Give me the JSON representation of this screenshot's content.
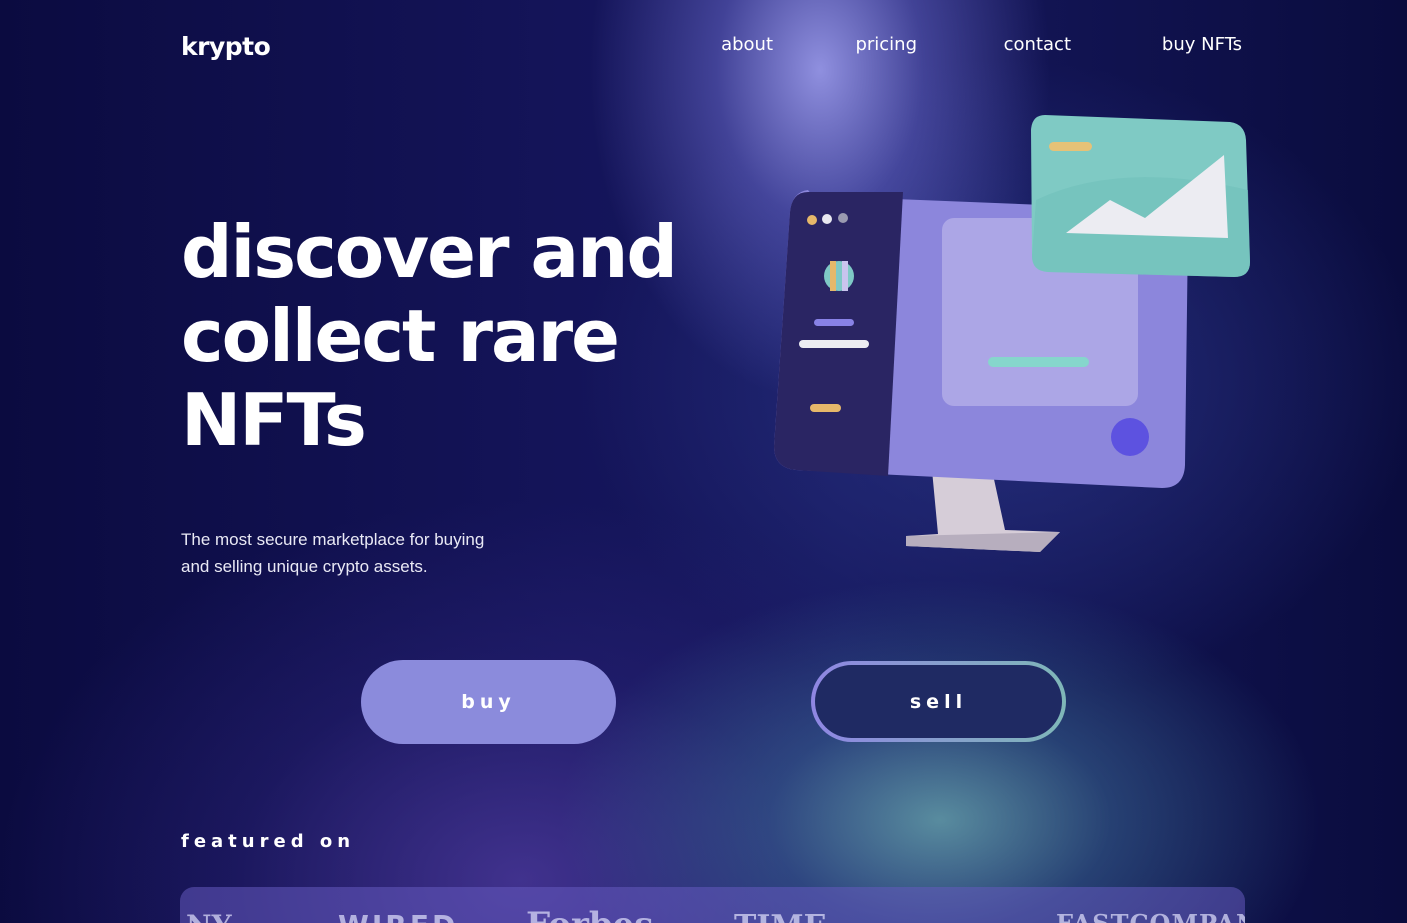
{
  "brand": {
    "logo": "krypto"
  },
  "nav": {
    "items": [
      {
        "label": "about"
      },
      {
        "label": "pricing"
      },
      {
        "label": "contact"
      },
      {
        "label": "buy NFTs"
      }
    ]
  },
  "hero": {
    "title_lines": [
      "discover and",
      "collect rare",
      "NFTs"
    ],
    "subtitle_lines": [
      "The most secure marketplace for buying",
      "and selling unique crypto assets."
    ]
  },
  "actions": {
    "buy_label": "buy",
    "sell_label": "sell"
  },
  "featured": {
    "title": "featured on",
    "logos": [
      "NY",
      "WIRED",
      "Forbes",
      "TIME",
      "FASTCOMPANY"
    ]
  },
  "colors": {
    "accent": "#8b8bdc",
    "teal": "#7fc9c6",
    "background": "#0b0c45"
  },
  "illustration": {
    "name": "monitor-nft-illustration"
  }
}
